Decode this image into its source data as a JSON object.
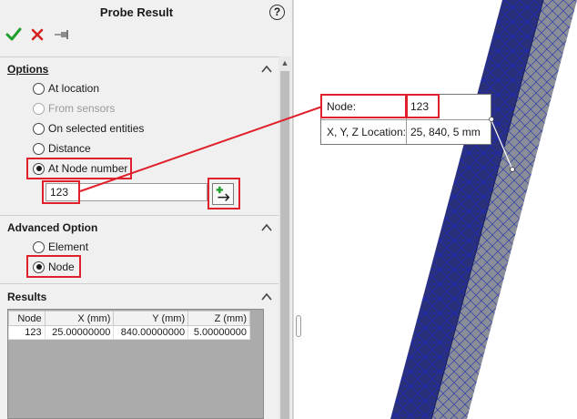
{
  "panel": {
    "title": "Probe Result",
    "help": "?",
    "icons": [
      "ok-checkmark-icon",
      "cancel-x-icon",
      "pushpin-icon",
      "help-icon",
      "collapse-chevron-icon",
      "pick-node-arrow-icon"
    ]
  },
  "options": {
    "title": "Options",
    "choices": [
      {
        "label": "At location",
        "selected": false,
        "enabled": true
      },
      {
        "label": "From sensors",
        "selected": false,
        "enabled": false
      },
      {
        "label": "On selected entities",
        "selected": false,
        "enabled": true
      },
      {
        "label": "Distance",
        "selected": false,
        "enabled": true
      },
      {
        "label": "At Node number",
        "selected": true,
        "enabled": true
      }
    ],
    "node_number_value": "123"
  },
  "advanced": {
    "title": "Advanced Option",
    "choices": [
      {
        "label": "Element",
        "selected": false
      },
      {
        "label": "Node",
        "selected": true
      }
    ]
  },
  "results": {
    "title": "Results",
    "columns": [
      "Node",
      "X (mm)",
      "Y (mm)",
      "Z (mm)"
    ],
    "rows": [
      [
        "123",
        "25.00000000",
        "840.00000000",
        "5.00000000"
      ]
    ]
  },
  "callout": {
    "node_key": "Node:",
    "node_value": "123",
    "location_key": "X, Y, Z Location:",
    "location_value": "25, 840, 5 mm"
  },
  "colors": {
    "highlight": "#e0212b",
    "mesh_face": "#2a3178",
    "mesh_edge": "#1f27b8",
    "mesh_side": "#8a8e99",
    "ok_green": "#1e9e2d",
    "cancel_red": "#d42020"
  }
}
